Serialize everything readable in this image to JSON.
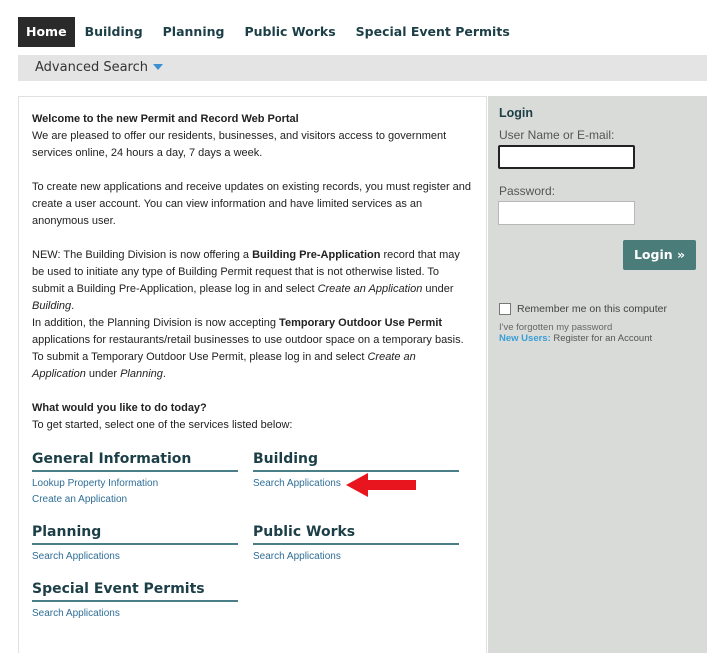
{
  "nav": {
    "tabs": [
      {
        "label": "Home",
        "active": true
      },
      {
        "label": "Building",
        "active": false
      },
      {
        "label": "Planning",
        "active": false
      },
      {
        "label": "Public Works",
        "active": false
      },
      {
        "label": "Special Event Permits",
        "active": false
      }
    ],
    "advanced_search": "Advanced Search"
  },
  "welcome": {
    "title": "Welcome to the new Permit and Record Web Portal",
    "intro": "We are pleased to offer our residents, businesses, and visitors access to government services online, 24 hours a day, 7 days a week.",
    "register_note": "To create new applications and receive updates on existing records, you must register and create a user account. You can view information and have limited services as an anonymous user.",
    "new_1_a": "NEW: The Building Division is now offering a ",
    "new_1_b": "Building Pre-Application",
    "new_1_c": " record that may be used to initiate any type of Building Permit request that is not otherwise listed. To submit a Building Pre-Application, please log in and select ",
    "new_1_d": "Create an Application",
    "new_1_e": " under ",
    "new_1_f": "Building",
    "new_1_g": ".",
    "new_2_a": "In addition, the Planning Division is now accepting ",
    "new_2_b": "Temporary Outdoor Use Permit",
    "new_2_c": " applications for restaurants/retail businesses to use outdoor space on a temporary basis. To submit a Temporary Outdoor Use Permit, please log in and select ",
    "new_2_d": "Create an Application",
    "new_2_e": " under ",
    "new_2_f": "Planning",
    "new_2_g": ".",
    "todo_title": "What would you like to do today?",
    "todo_sub": "To get started, select one of the services listed below:"
  },
  "sections": {
    "general": {
      "title": "General Information",
      "links": [
        "Lookup Property Information",
        "Create an Application"
      ]
    },
    "building": {
      "title": "Building",
      "links": [
        "Search Applications"
      ]
    },
    "planning": {
      "title": "Planning",
      "links": [
        "Search Applications"
      ]
    },
    "public_works": {
      "title": "Public Works",
      "links": [
        "Search Applications"
      ]
    },
    "special": {
      "title": "Special Event Permits",
      "links": [
        "Search Applications"
      ]
    }
  },
  "login": {
    "title": "Login",
    "username_label": "User Name or E-mail:",
    "username_value": "",
    "password_label": "Password:",
    "password_value": "",
    "button": "Login »",
    "remember": "Remember me on this computer",
    "forgot": "I've forgotten my password",
    "new_users": "New Users:",
    "register": " Register for an Account"
  },
  "colors": {
    "heading": "#1c3f47",
    "link": "#2e6e96",
    "login_button": "#4a7c7a",
    "annotation_arrow": "#e8141e"
  }
}
